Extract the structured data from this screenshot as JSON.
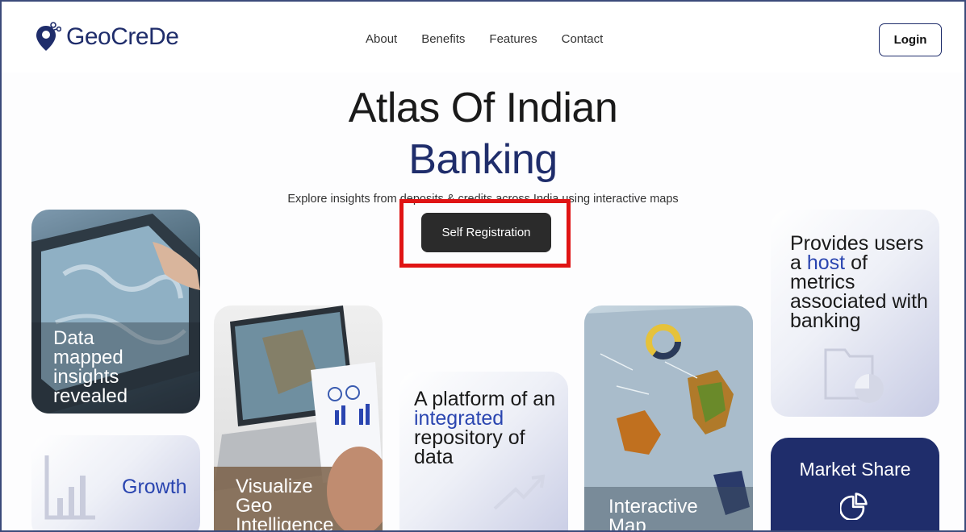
{
  "header": {
    "brand": "GeoCreDe",
    "nav": [
      "About",
      "Benefits",
      "Features",
      "Contact"
    ],
    "login_label": "Login"
  },
  "hero": {
    "title_line1": "Atlas Of Indian",
    "title_line2": "Banking",
    "subtitle": "Explore insights from deposits & credits across India using interactive maps",
    "cta_label": "Self Registration"
  },
  "cards": {
    "data_mapped": "Data mapped insights revealed",
    "growth": "Growth",
    "visualize": "Visualize Geo Intelligence",
    "platform_a": "A platform of an ",
    "platform_b": "integrated",
    "platform_c": " repository of data",
    "interactive_map": "Interactive Map",
    "provides_a": "Provides users a ",
    "provides_b": "host",
    "provides_c": " of metrics associated with banking",
    "market_share": "Market Share"
  },
  "colors": {
    "brand_navy": "#1f2d6b",
    "cta_dark": "#2b2b2b",
    "highlight_red": "#e01414"
  },
  "icons": {
    "logo": "location-pin-icon",
    "growth": "bar-chart-icon",
    "platform": "trend-up-arrow-icon",
    "provides": "folder-chart-icon",
    "market_share": "pie-chart-icon"
  }
}
